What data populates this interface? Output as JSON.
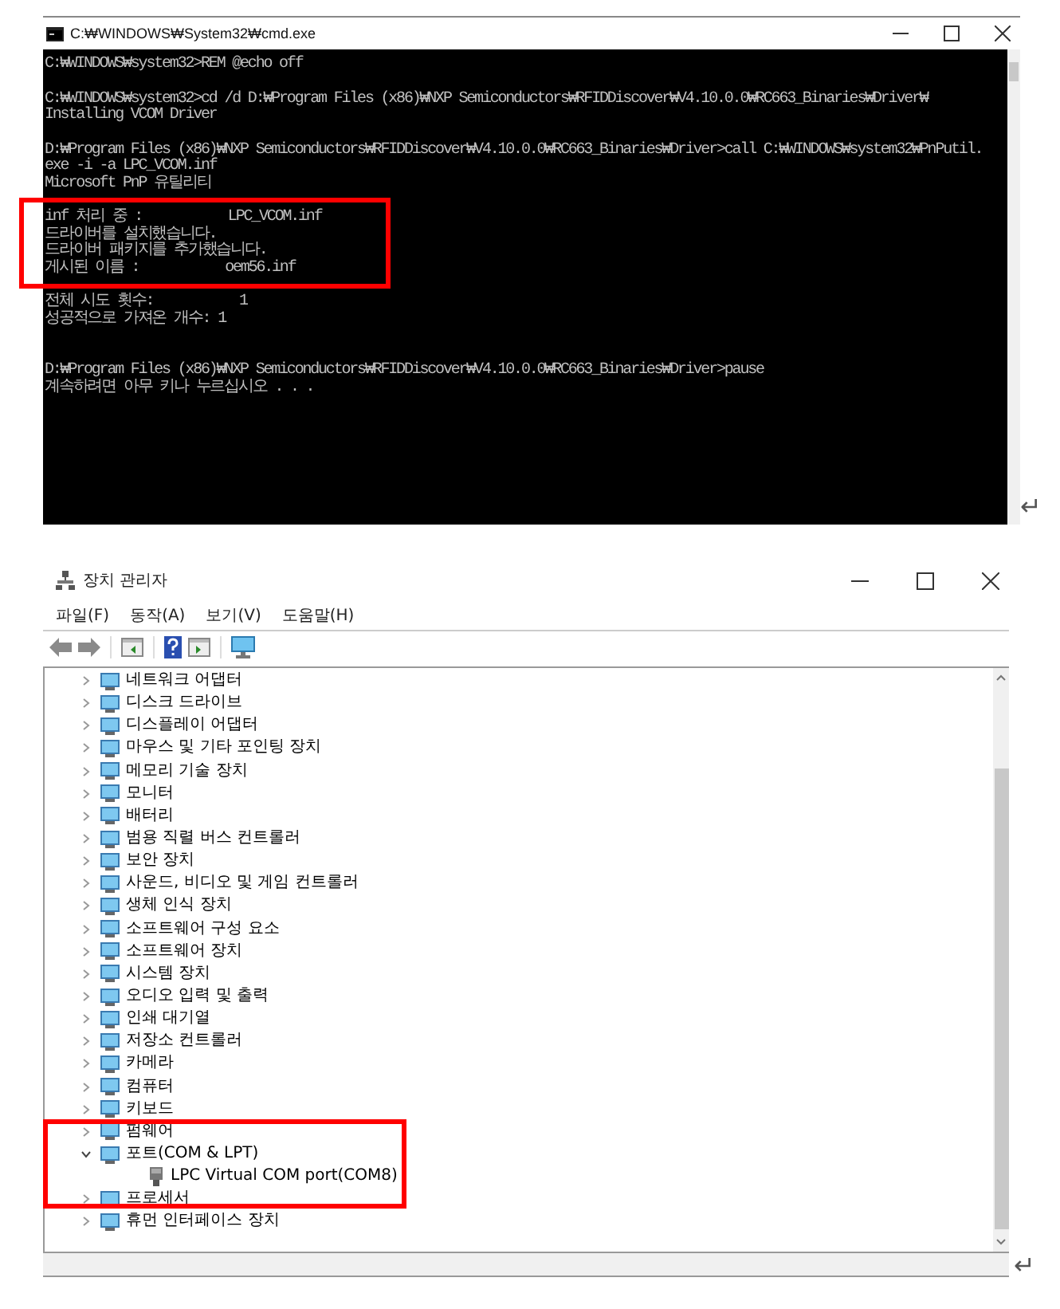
{
  "console_window": {
    "title": "C:₩WINDOWS₩System32₩cmd.exe",
    "blocks": [
      {
        "lines": [
          "C:₩WINDOWS₩system32>REM @echo off"
        ]
      },
      {
        "lines": [
          "C:₩WINDOWS₩system32>cd /d D:₩Program Files (x86)₩NXP Semiconductors₩RFIDDiscover₩V4.10.0.0₩RC663_Binaries₩Driver₩",
          "Installing VCOM Driver"
        ]
      },
      {
        "lines": [
          "D:₩Program Files (x86)₩NXP Semiconductors₩RFIDDiscover₩V4.10.0.0₩RC663_Binaries₩Driver>call C:₩WINDOWS₩system32₩PnPutil.",
          "exe -i -a LPC_VCOM.inf",
          "Microsoft PnP 유틸리티"
        ]
      },
      {
        "lines": [
          "inf 처리 중 :           LPC_VCOM.inf",
          "드라이버를 설치했습니다.",
          "드라이버 패키지를 추가했습니다.",
          "게시된 이름 :           oem56.inf"
        ]
      },
      {
        "lines": [
          "전체 시도 횟수:           1",
          "성공적으로 가져온 개수: 1"
        ]
      },
      {
        "lines": [
          "D:₩Program Files (x86)₩NXP Semiconductors₩RFIDDiscover₩V4.10.0.0₩RC663_Binaries₩Driver>pause",
          "계속하려면 아무 키나 누르십시오 . . ."
        ]
      }
    ],
    "paragraph_mark": "↵"
  },
  "device_manager": {
    "title": "장치 관리자",
    "menu": [
      "파일(F)",
      "동작(A)",
      "보기(V)",
      "도움말(H)"
    ],
    "tree": [
      {
        "label": "네트워크 어댑터",
        "expanded": false
      },
      {
        "label": "디스크 드라이브",
        "expanded": false
      },
      {
        "label": "디스플레이 어댑터",
        "expanded": false
      },
      {
        "label": "마우스 및 기타 포인팅 장치",
        "expanded": false
      },
      {
        "label": "메모리 기술 장치",
        "expanded": false
      },
      {
        "label": "모니터",
        "expanded": false
      },
      {
        "label": "배터리",
        "expanded": false
      },
      {
        "label": "범용 직렬 버스 컨트롤러",
        "expanded": false
      },
      {
        "label": "보안 장치",
        "expanded": false
      },
      {
        "label": "사운드, 비디오 및 게임 컨트롤러",
        "expanded": false
      },
      {
        "label": "생체 인식 장치",
        "expanded": false
      },
      {
        "label": "소프트웨어 구성 요소",
        "expanded": false
      },
      {
        "label": "소프트웨어 장치",
        "expanded": false
      },
      {
        "label": "시스템 장치",
        "expanded": false
      },
      {
        "label": "오디오 입력 및 출력",
        "expanded": false
      },
      {
        "label": "인쇄 대기열",
        "expanded": false
      },
      {
        "label": "저장소 컨트롤러",
        "expanded": false
      },
      {
        "label": "카메라",
        "expanded": false
      },
      {
        "label": "컴퓨터",
        "expanded": false
      },
      {
        "label": "키보드",
        "expanded": false
      },
      {
        "label": "펌웨어",
        "expanded": false
      },
      {
        "label": "포트(COM & LPT)",
        "expanded": true,
        "children": [
          {
            "label": "LPC Virtual COM port(COM8)"
          }
        ]
      },
      {
        "label": "프로세서",
        "expanded": false
      },
      {
        "label": "휴먼 인터페이스 장치",
        "expanded": false
      }
    ],
    "paragraph_mark": "↵"
  }
}
